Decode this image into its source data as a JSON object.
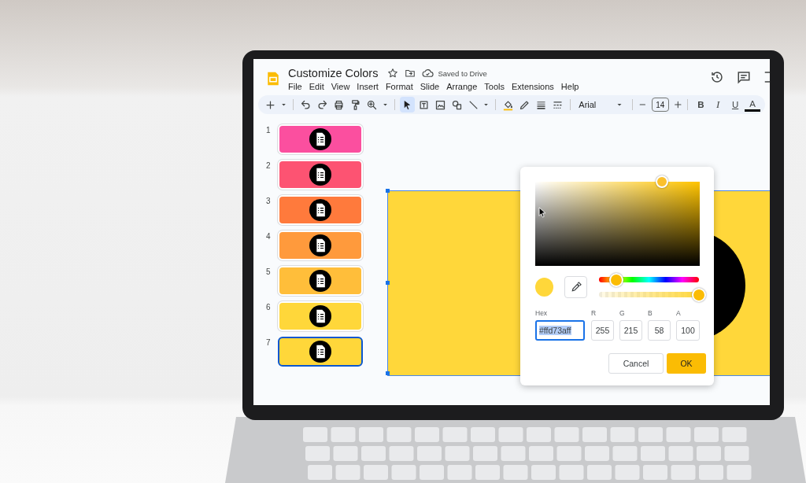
{
  "document": {
    "title": "Customize Colors",
    "save_status": "Saved to Drive"
  },
  "menu": [
    "File",
    "Edit",
    "View",
    "Insert",
    "Format",
    "Slide",
    "Arrange",
    "Tools",
    "Extensions",
    "Help"
  ],
  "toolbar": {
    "tool_groups": [
      [
        {
          "kind": "plus",
          "selected": false
        },
        {
          "kind": "caret",
          "selected": false
        }
      ],
      [
        {
          "kind": "undo",
          "selected": false
        },
        {
          "kind": "redo",
          "selected": false
        },
        {
          "kind": "print",
          "selected": false
        },
        {
          "kind": "paint-format",
          "selected": false
        },
        {
          "kind": "zoom",
          "selected": false
        },
        {
          "kind": "caret",
          "selected": false
        }
      ],
      [
        {
          "kind": "select",
          "selected": true
        },
        {
          "kind": "textbox",
          "selected": false
        },
        {
          "kind": "image",
          "selected": false
        },
        {
          "kind": "shapes",
          "selected": false
        },
        {
          "kind": "line",
          "selected": false
        },
        {
          "kind": "caret",
          "selected": false
        }
      ],
      [
        {
          "kind": "fill",
          "selected": false
        },
        {
          "kind": "pen",
          "selected": false
        },
        {
          "kind": "line-weight",
          "selected": false
        },
        {
          "kind": "line-dash",
          "selected": false
        }
      ]
    ],
    "font": "Arial",
    "font_size": "14",
    "format_buttons": [
      {
        "kind": "bold",
        "label": "B"
      },
      {
        "kind": "italic",
        "label": "I"
      },
      {
        "kind": "underline",
        "label": "U"
      },
      {
        "kind": "text-color",
        "label": "A"
      }
    ]
  },
  "slides": [
    {
      "number": "1",
      "color": "#fb4f9f",
      "selected": false
    },
    {
      "number": "2",
      "color": "#fd5372",
      "selected": false
    },
    {
      "number": "3",
      "color": "#ff7a3c",
      "selected": false
    },
    {
      "number": "4",
      "color": "#ff9a3c",
      "selected": false
    },
    {
      "number": "5",
      "color": "#ffbe3a",
      "selected": false
    },
    {
      "number": "6",
      "color": "#ffd73a",
      "selected": false
    },
    {
      "number": "7",
      "color": "#ffd73a",
      "selected": true
    }
  ],
  "color_picker": {
    "color_field": {
      "level": 0.77
    },
    "hue_slider": {
      "level": 0.17
    },
    "alpha_slider": {
      "level": 1
    },
    "hex": {
      "label": "Hex",
      "value": "#ffd73aff",
      "text_selected": true
    },
    "channels": [
      {
        "label": "R",
        "value": "255"
      },
      {
        "label": "G",
        "value": "215"
      },
      {
        "label": "B",
        "value": "58"
      },
      {
        "label": "A",
        "value": "100"
      }
    ],
    "buttons": [
      {
        "kind": "secondary",
        "label": "Cancel"
      },
      {
        "kind": "primary",
        "label": "OK"
      }
    ]
  }
}
